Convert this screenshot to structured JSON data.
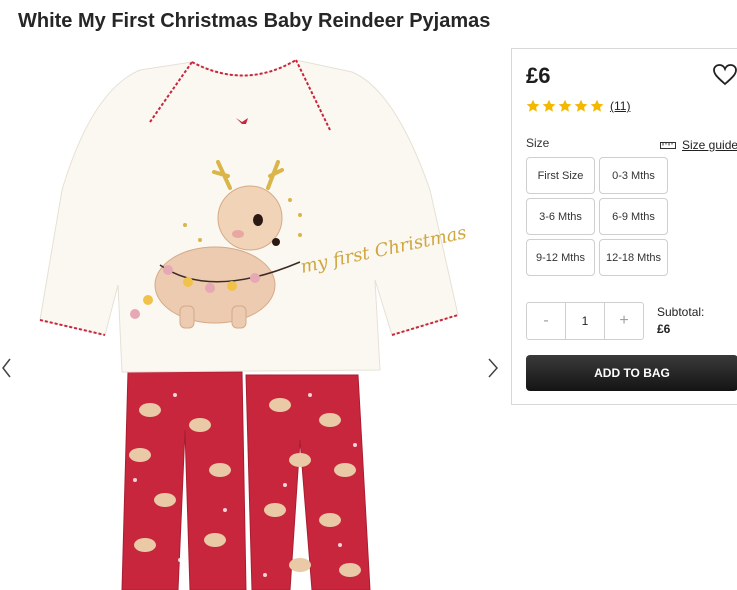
{
  "product": {
    "title": "White My First Christmas Baby Reindeer Pyjamas",
    "image_alt": "White My First Christmas Baby Reindeer Pyjamas product image",
    "image_text": "my first Christmas"
  },
  "purchase": {
    "price": "£6",
    "rating": 5,
    "review_count": "(11)",
    "size_label": "Size",
    "size_guide_label": "Size guide",
    "sizes": [
      "First Size",
      "0-3 Mths",
      "3-6 Mths",
      "6-9 Mths",
      "9-12 Mths",
      "12-18 Mths"
    ],
    "quantity": "1",
    "decrement_label": "-",
    "increment_label": "+",
    "subtotal_label": "Subtotal:",
    "subtotal_value": "£6",
    "add_to_bag_label": "ADD TO BAG"
  },
  "colors": {
    "pyjama_red": "#c8263d",
    "top_white": "#fbf8f1",
    "star_gold": "#f5b800",
    "button_dark": "#1e1e1e"
  }
}
